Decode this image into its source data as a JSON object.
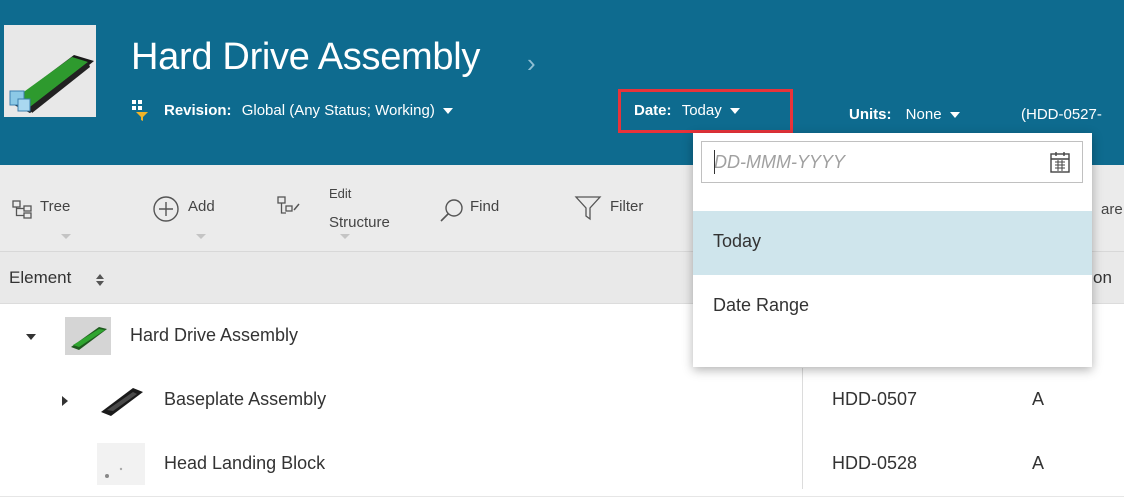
{
  "header": {
    "title": "Hard Drive Assembly",
    "revision_label": "Revision:",
    "revision_value": "Global (Any Status; Working)",
    "date_label": "Date:",
    "date_value": "Today",
    "units_label": "Units:",
    "units_value": "None",
    "context_id": "(HDD-0527-"
  },
  "toolbar": {
    "tree": "Tree",
    "add": "Add",
    "edit_line1": "Edit",
    "edit_line2": "Structure",
    "find": "Find",
    "filter": "Filter",
    "compare_partial": "are"
  },
  "table": {
    "col_element": "Element",
    "col_partial": "on",
    "rows": [
      {
        "name": "Hard Drive Assembly",
        "number": "",
        "rev": ""
      },
      {
        "name": "Baseplate Assembly",
        "number": "HDD-0507",
        "rev": "A"
      },
      {
        "name": "Head Landing Block",
        "number": "HDD-0528",
        "rev": "A"
      }
    ]
  },
  "date_dropdown": {
    "placeholder": "DD-MMM-YYYY",
    "options": [
      "Today",
      "Date Range"
    ],
    "selected": "Today"
  },
  "colors": {
    "header_bg": "#0e6b8f",
    "highlight_border": "#e8333a",
    "selected_option_bg": "#cfe5ec"
  }
}
